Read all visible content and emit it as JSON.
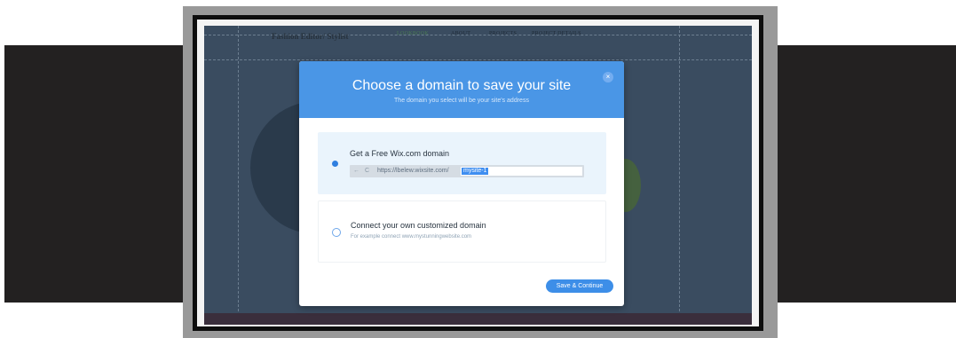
{
  "background_page": {
    "site_title": "Fashion Editor/ Stylist",
    "nav_items": [
      "ABOUT",
      "PROJECTS",
      "PROJECT DETAILS"
    ],
    "nav_active": "LOOKBOOK"
  },
  "dialog": {
    "title": "Choose a domain to save your site",
    "subtitle": "The domain you select will be your site's address",
    "close_icon": "×",
    "free_option": {
      "label": "Get a Free Wix.com domain",
      "url_prefix": "https://lbelew.wixsite.com/",
      "site_name_value": "mysite-1",
      "nav_icons": "← C",
      "selected": true
    },
    "custom_option": {
      "label": "Connect your own customized domain",
      "hint": "For example connect www.mystunningwebsite.com",
      "selected": false
    },
    "save_button_label": "Save & Continue"
  },
  "colors": {
    "header": "#4a96e6",
    "button": "#3d8ee8",
    "selection": "#3f8ef0",
    "overlay": "#3a4c60"
  }
}
